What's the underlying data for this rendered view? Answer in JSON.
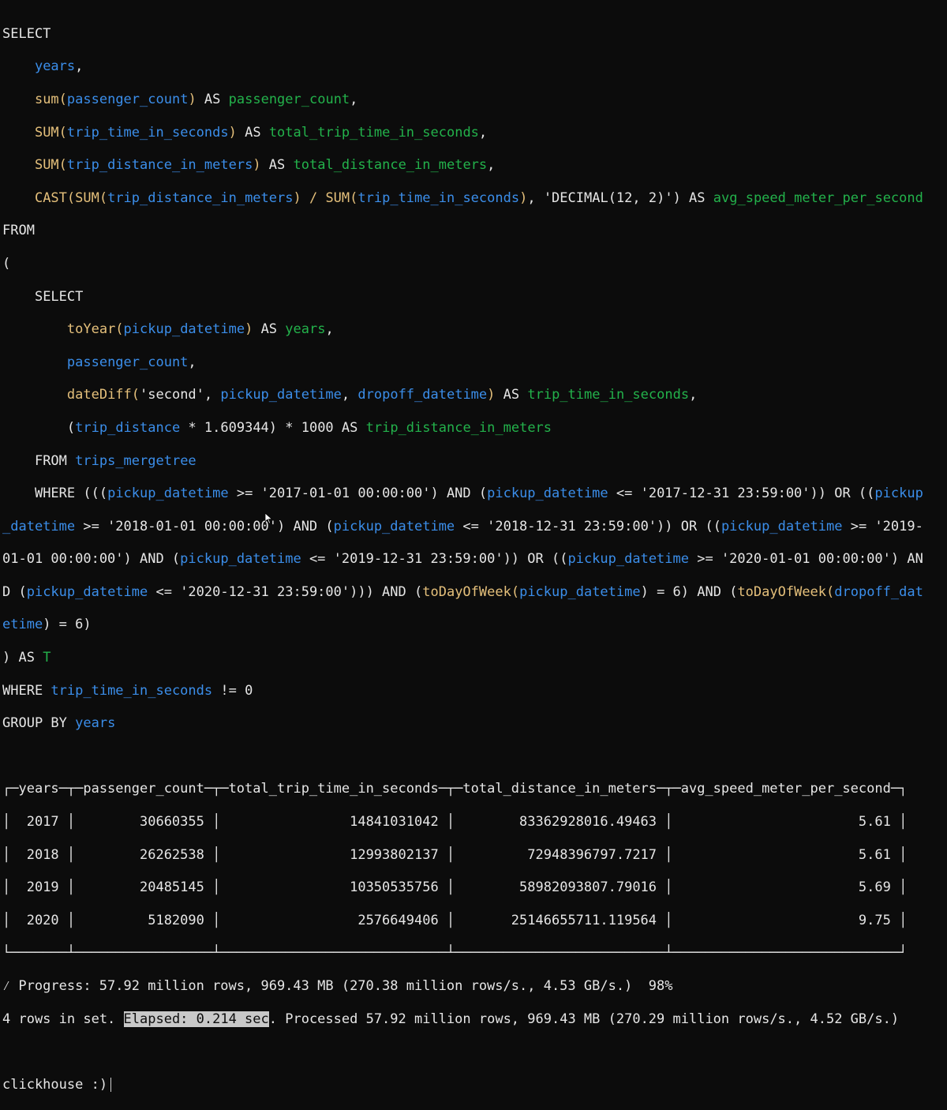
{
  "terminal": {
    "query": {
      "l1": {
        "a": "SELECT"
      },
      "l2": {
        "a": "years",
        "b": ","
      },
      "l3": {
        "f": "sum(",
        "a": "passenger_count",
        "b": ")",
        "c": " AS ",
        "d": "passenger_count",
        "e": ","
      },
      "l4": {
        "f": "SUM(",
        "a": "trip_time_in_seconds",
        "b": ")",
        "c": " AS ",
        "d": "total_trip_time_in_seconds",
        "e": ","
      },
      "l5": {
        "f": "SUM(",
        "a": "trip_distance_in_meters",
        "b": ")",
        "c": " AS ",
        "d": "total_distance_in_meters",
        "e": ","
      },
      "l6": {
        "f": "CAST(SUM(",
        "a": "trip_distance_in_meters",
        "b": ") / ",
        "f2": "SUM(",
        "a2": "trip_time_in_seconds",
        "b2": ")",
        "s": ", 'DECIMAL(12, 2)')",
        "c": " AS ",
        "d": "avg_speed_meter_per_second"
      },
      "l7": {
        "a": "FROM"
      },
      "l8": {
        "a": "("
      },
      "l9": {
        "a": "SELECT"
      },
      "l10": {
        "f": "toYear(",
        "a": "pickup_datetime",
        "b": ")",
        "c": " AS ",
        "d": "years",
        "e": ","
      },
      "l11": {
        "a": "passenger_count",
        "b": ","
      },
      "l12": {
        "f": "dateDiff(",
        "s": "'second', ",
        "a": "pickup_datetime",
        "b": ", ",
        "a2": "dropoff_datetime",
        "b2": ")",
        "c": " AS ",
        "d": "trip_time_in_seconds",
        "e": ","
      },
      "l13": {
        "p": "(",
        "a": "trip_distance",
        "n": " * 1.609344) * 1000",
        "c": " AS ",
        "d": "trip_distance_in_meters"
      },
      "l14": {
        "c": "FROM ",
        "a": "trips_mergetree"
      },
      "l15": {
        "c": "WHERE (((",
        "a": "pickup_datetime",
        "n": " >= '2017-01-01 00:00:00') AND (",
        "a2": "pickup_datetime",
        "n2": " <= '2017-12-31 23:59:00')) OR ((",
        "a3": "pickup"
      },
      "l16": {
        "a": "_datetime",
        "n": " >= '2018-01-01 00:00:00') AND (",
        "a2": "pickup_datetime",
        "n2": " <= '2018-12-31 23:59:00')) OR ((",
        "a3": "pickup_datetime",
        "n3": " >= '2019-"
      },
      "l17": {
        "n": "01-01 00:00:00') AND (",
        "a": "pickup_datetime",
        "n2": " <= '2019-12-31 23:59:00')) OR ((",
        "a2": "pickup_datetime",
        "n3": " >= '2020-01-01 00:00:00') AN"
      },
      "l18": {
        "n": "D (",
        "a": "pickup_datetime",
        "n2": " <= '2020-12-31 23:59:00'))) AND (",
        "f": "toDayOfWeek(",
        "a2": "pickup_datetime",
        "n3": ") = 6) AND (",
        "f2": "toDayOfWeek(",
        "a3": "dropoff_dat"
      },
      "l19": {
        "a": "etime",
        "n": ") = 6)"
      },
      "l20": {
        "n": ") AS ",
        "d": "T"
      },
      "l21": {
        "n": "WHERE ",
        "a": "trip_time_in_seconds",
        "n2": " != 0"
      },
      "l22": {
        "n": "GROUP BY ",
        "a": "years"
      }
    },
    "table": {
      "top": "┌─years─┬─passenger_count─┬─total_trip_time_in_seconds─┬─total_distance_in_meters─┬─avg_speed_meter_per_second─┐",
      "rows": [
        "│  2017 │        30660355 │                14841031042 │        83362928016.49463 │                       5.61 │",
        "│  2018 │        26262538 │                12993802137 │         72948396797.7217 │                       5.61 │",
        "│  2019 │        20485145 │                10350535756 │        58982093807.79016 │                       5.69 │",
        "│  2020 │         5182090 │                 2576649406 │       25146655711.119564 │                       9.75 │"
      ],
      "bottom": "└───────┴─────────────────┴────────────────────────────┴──────────────────────────┴────────────────────────────┘"
    },
    "progress": "⁄ Progress: 57.92 million rows, 969.43 MB (270.38 million rows/s., 4.53 GB/s.)  98%",
    "result": {
      "pre": "4 rows in set. ",
      "elapsed": "Elapsed: 0.214 sec",
      "post": ". Processed 57.92 million rows, 969.43 MB (270.29 million rows/s., 4.52 GB/s.)"
    },
    "prompt": "clickhouse :)"
  }
}
